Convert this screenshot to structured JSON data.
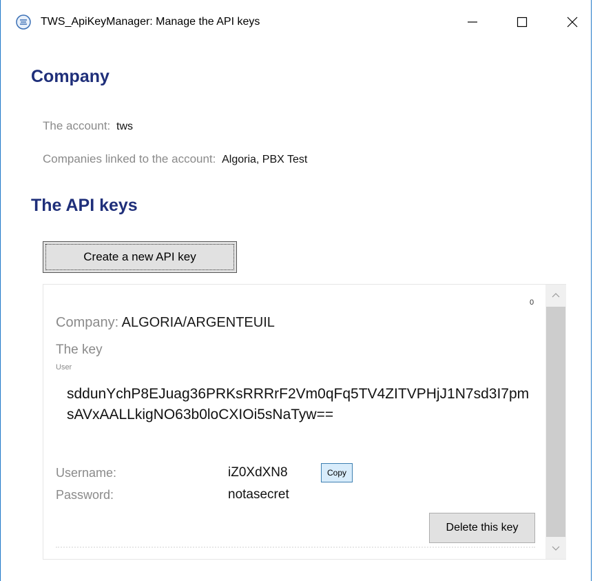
{
  "window": {
    "title": "TWS_ApiKeyManager: Manage the API keys",
    "icon": "app-icon"
  },
  "company_section": {
    "title": "Company",
    "account_label": "The account:",
    "account_value": "tws",
    "linked_label": "Companies linked to the account:",
    "linked_value": "Algoria, PBX Test"
  },
  "api_keys_section": {
    "title": "The API keys",
    "create_button": "Create a new API key"
  },
  "key_panel": {
    "counter": "0",
    "company_label": "Company:",
    "company_value": "ALGORIA/ARGENTEUIL",
    "key_label": "The key",
    "user_tag": "User",
    "key_value": "sddunYchP8EJuag36PRKsRRRrF2Vm0qFq5TV4ZITVPHjJ1N7sd3I7pmsAVxAALLkigNO63b0loCXIOi5sNaTyw==",
    "username_label": "Username:",
    "username_value": "iZ0XdXN8",
    "copy_button": "Copy",
    "password_label": "Password:",
    "password_value": "notasecret",
    "delete_button": "Delete this key"
  },
  "colors": {
    "heading": "#1f2f7a",
    "label": "#8a8a8a",
    "window_border": "#1e78c8",
    "copy_button_bg": "#d8ecfb"
  }
}
